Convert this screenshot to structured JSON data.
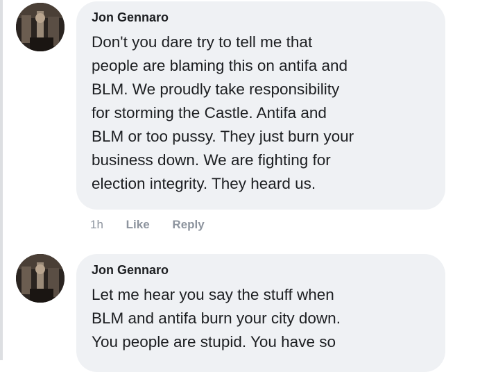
{
  "comments": [
    {
      "author": "Jon Gennaro",
      "text": "Don't you dare try to tell me that\npeople are blaming this on antifa and\nBLM. We proudly take responsibility\nfor storming the Castle. Antifa and\nBLM or too pussy. They just burn your\nbusiness down. We are fighting for\nelection integrity. They heard us.",
      "time": "1h",
      "like_label": "Like",
      "reply_label": "Reply"
    },
    {
      "author": "Jon Gennaro",
      "text": "Let me hear you say the stuff when\nBLM and antifa burn your city down.\nYou people are stupid. You have so"
    }
  ],
  "colors": {
    "bubble": "#eff1f4",
    "text": "#1c1e21",
    "meta": "#8d949e"
  }
}
